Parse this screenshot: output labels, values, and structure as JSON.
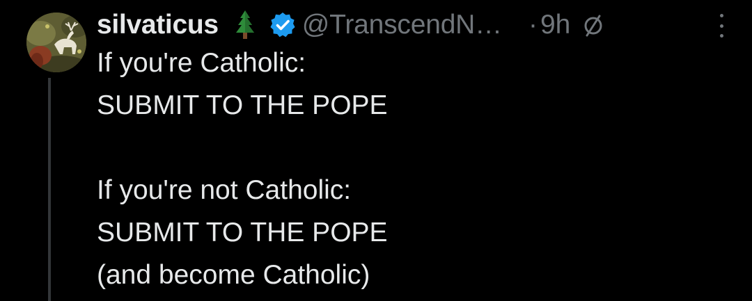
{
  "post": {
    "author": {
      "display_name": "silvaticus",
      "name_emoji": "evergreen-tree-icon",
      "verified": true,
      "handle": "@TranscendN…",
      "avatar": "avatar-medieval-painting-white-stag"
    },
    "separator": "·",
    "time": "9h",
    "status_icon": "circle-slash-icon",
    "more_icon": "more-vertical-icon",
    "lines": [
      "If you're Catholic:",
      "SUBMIT TO THE POPE",
      "",
      "If you're not Catholic:",
      "SUBMIT TO THE POPE",
      "(and become Catholic)"
    ]
  },
  "colors": {
    "background": "#000000",
    "text_primary": "#e7e9ea",
    "text_secondary": "#71767b",
    "verified_blue": "#1d9bf0",
    "thread_line": "#333639"
  }
}
